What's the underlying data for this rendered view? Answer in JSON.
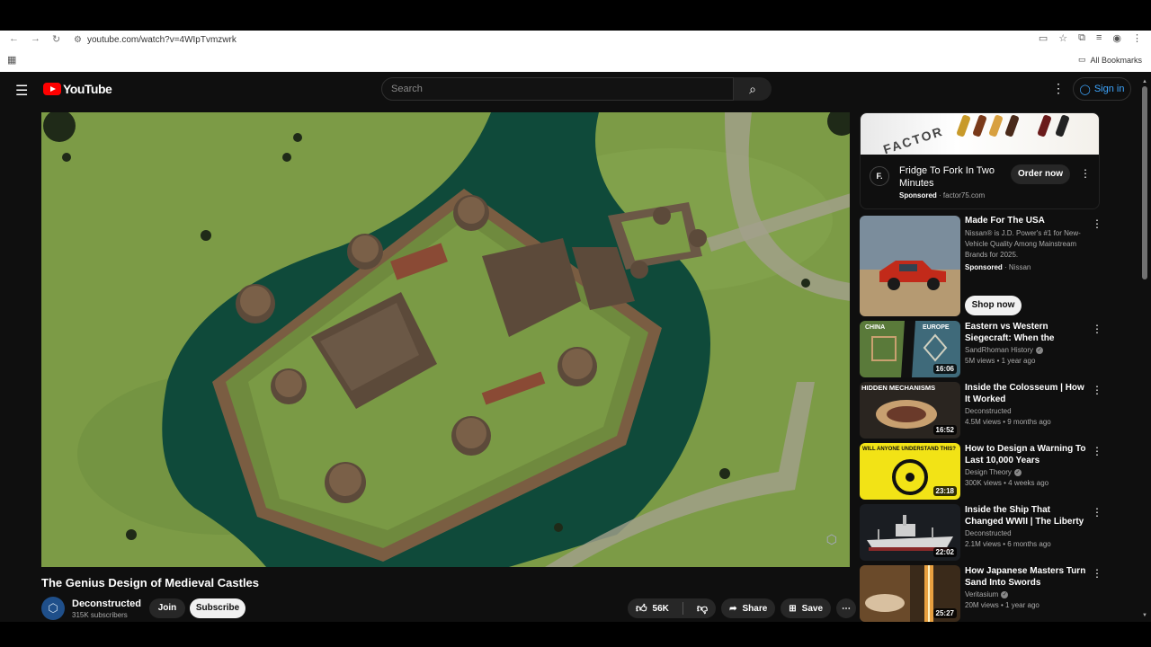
{
  "browser": {
    "url": "youtube.com/watch?v=4WIpTvmzwrk",
    "bookmarks_label": "All Bookmarks"
  },
  "masthead": {
    "logo_text": "YouTube",
    "search_placeholder": "Search",
    "signin_label": "Sign in"
  },
  "video": {
    "title": "The Genius Design of Medieval Castles",
    "channel": "Deconstructed",
    "subscribers": "315K subscribers",
    "join_label": "Join",
    "subscribe_label": "Subscribe",
    "likes": "56K",
    "share_label": "Share",
    "save_label": "Save"
  },
  "sidebar": {
    "ad1": {
      "logo_letter": "F.",
      "image_word": "FACTOR",
      "title": "Fridge To Fork In Two Minutes",
      "sponsored": "Sponsored",
      "domain": "factor75.com",
      "cta": "Order now"
    },
    "ad2": {
      "title": "Made For The USA",
      "description": "Nissan® is J.D. Power's #1 for New-Vehicle Quality Among Mainstream Brands for 2025.",
      "sponsored": "Sponsored",
      "advertiser": "Nissan",
      "cta": "Shop now"
    },
    "recs": [
      {
        "title": "Eastern vs Western Siegecraft: When the Chinese Besieged a ...",
        "channel": "SandRhoman History",
        "views": "5M views",
        "age": "1 year ago",
        "duration": "16:06",
        "thumb_label_left": "CHINA",
        "thumb_label_right": "EUROPE"
      },
      {
        "title": "Inside the Colosseum | How It Worked",
        "channel": "Deconstructed",
        "views": "4.5M views",
        "age": "9 months ago",
        "duration": "16:52",
        "thumb_label": "HIDDEN MECHANISMS"
      },
      {
        "title": "How to Design a Warning To Last 10,000 Years",
        "channel": "Design Theory",
        "views": "300K views",
        "age": "4 weeks ago",
        "duration": "23:18",
        "thumb_label": "WILL ANYONE UNDERSTAND THIS?"
      },
      {
        "title": "Inside the Ship That Changed WWII | The Liberty Ship",
        "channel": "Deconstructed",
        "views": "2.1M views",
        "age": "6 months ago",
        "duration": "22:02"
      },
      {
        "title": "How Japanese Masters Turn Sand Into Swords",
        "channel": "Veritasium",
        "views": "20M views",
        "age": "1 year ago",
        "duration": "25:27"
      }
    ]
  },
  "colors": {
    "youtube_red": "#ff0000",
    "page_bg": "#0f0f0f",
    "link_blue": "#3ea6ff"
  }
}
